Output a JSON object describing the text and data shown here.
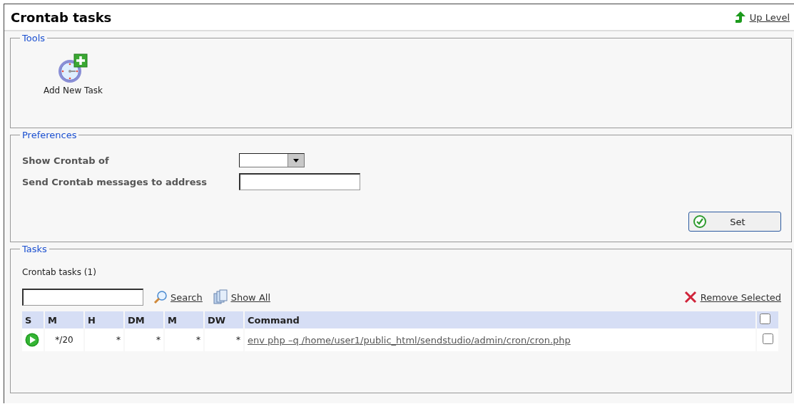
{
  "page": {
    "title": "Crontab tasks",
    "up_link": "Up Level"
  },
  "tools": {
    "legend": "Tools",
    "items": [
      {
        "label": "Add New Task"
      }
    ]
  },
  "preferences": {
    "legend": "Preferences",
    "fields": [
      {
        "label": "Show Crontab of",
        "kind": "select"
      },
      {
        "label": "Send Crontab messages to address",
        "kind": "text"
      }
    ],
    "button": "Set"
  },
  "tasks": {
    "legend": "Tasks",
    "count": "Crontab tasks (1)",
    "search_button": "Search",
    "show_all": "Show All",
    "remove_selected": "Remove Selected",
    "columns": [
      "S",
      "M",
      "H",
      "DM",
      "M",
      "DW",
      "Command"
    ],
    "select_all": {
      "checked": false
    },
    "rows": [
      {
        "cells": [
          {
            "kind": "play"
          },
          "*/20",
          "*",
          "*",
          "*",
          "*",
          {
            "kind": "link",
            "text": "env php –q /home/user1/public_html/sendstudio/admin/cron/cron.php"
          }
        ],
        "checked": false
      }
    ]
  }
}
